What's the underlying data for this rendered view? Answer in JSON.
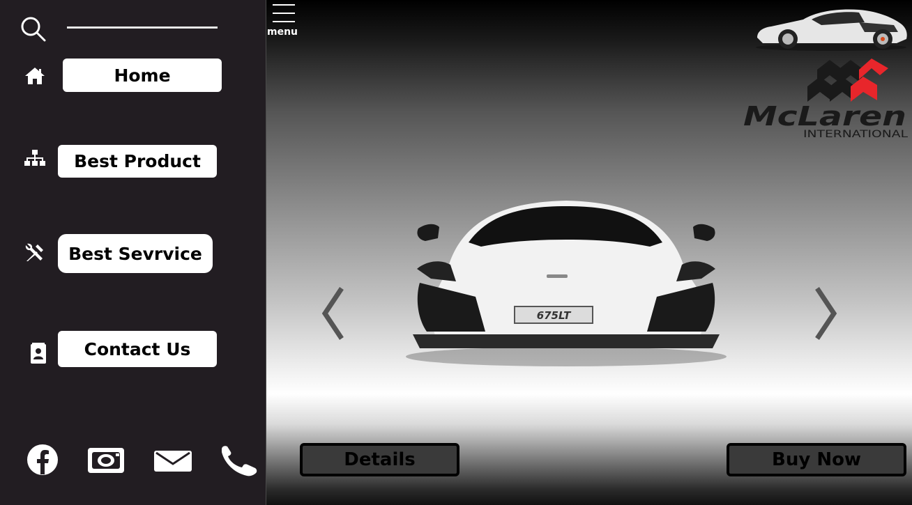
{
  "sidebar": {
    "search": {
      "icon": "search-icon"
    },
    "items": [
      {
        "label": "Home",
        "icon": "home-icon"
      },
      {
        "label": "Best Product",
        "icon": "sitemap-icon"
      },
      {
        "label": "Best Sevrvice",
        "icon": "tools-icon"
      },
      {
        "label": "Contact Us",
        "icon": "contact-card-icon"
      }
    ],
    "social": [
      {
        "icon": "facebook-icon"
      },
      {
        "icon": "camera-icon"
      },
      {
        "icon": "mail-icon"
      },
      {
        "icon": "phone-icon"
      }
    ]
  },
  "header": {
    "menu_label": "menu",
    "menu_icon": "hamburger-icon"
  },
  "brand": {
    "name": "McLaren",
    "subtitle": "INTERNATIONAL",
    "accent": "#e8262b"
  },
  "hero": {
    "plate_text": "675LT",
    "prev_icon": "chevron-left-icon",
    "next_icon": "chevron-right-icon"
  },
  "actions": {
    "details_label": "Details",
    "buy_label": "Buy Now"
  },
  "colors": {
    "sidebar_bg": "#221d22",
    "button_bg": "#ffffff",
    "action_bg": "#3a3a3a"
  }
}
